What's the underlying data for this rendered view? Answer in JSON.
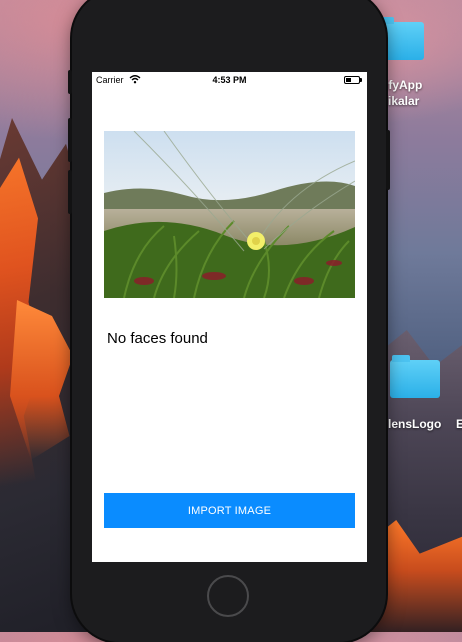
{
  "desktop": {
    "folder_top_label_line1": "tifyApp",
    "folder_top_label_line2": "fikalar",
    "folder_mid_label": "lensLogo",
    "edge_label": "E"
  },
  "status_bar": {
    "carrier": "Carrier",
    "time": "4:53 PM",
    "wifi_icon": "wifi-icon",
    "battery_icon": "battery-icon"
  },
  "main": {
    "image_description_icon": "photo-flower-grass",
    "result_text": "No faces found",
    "import_button_label": "IMPORT IMAGE"
  },
  "colors": {
    "button_bg": "#0a8cff",
    "button_text": "#ffffff",
    "phone_body": "#1c1c1e",
    "screen_bg": "#ffffff"
  }
}
